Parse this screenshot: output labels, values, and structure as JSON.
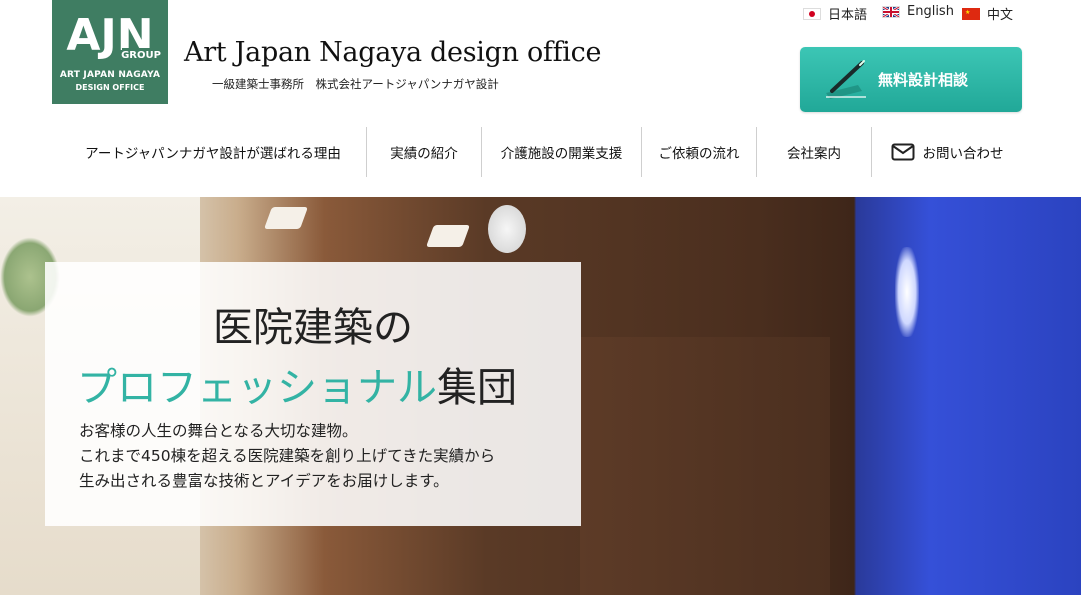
{
  "header": {
    "logo": {
      "mark": "AJN",
      "group": "GROUP",
      "line1": "ART JAPAN NAGAYA",
      "line2": "DESIGN OFFICE"
    },
    "title": "Art Japan Nagaya design office",
    "subtitle": "一級建築士事務所　株式会社アートジャパンナガヤ設計",
    "languages": [
      {
        "label": "日本語",
        "flag": "jp-flag-icon"
      },
      {
        "label": "English",
        "flag": "uk-flag-icon"
      },
      {
        "label": "中文",
        "flag": "cn-flag-icon"
      }
    ],
    "cta": {
      "label": "無料設計相談",
      "icon": "pen-icon"
    }
  },
  "nav": {
    "items": [
      {
        "label": "アートジャパンナガヤ設計が選ばれる理由"
      },
      {
        "label": "実績の紹介"
      },
      {
        "label": "介護施設の開業支援"
      },
      {
        "label": "ご依頼の流れ"
      },
      {
        "label": "会社案内"
      },
      {
        "label": "お問い合わせ",
        "icon": "mail-icon"
      }
    ]
  },
  "hero": {
    "heading_line1": "医院建築の",
    "heading_accent": "プロフェッショナル",
    "heading_rest": "集団",
    "body": [
      "お客様の人生の舞台となる大切な建物。",
      "これまで450棟を超える医院建築を創り上げてきた実績から",
      "生み出される豊富な技術とアイデアをお届けします。"
    ]
  },
  "colors": {
    "logo_bg": "#3f7d62",
    "accent": "#33b3a4",
    "cta_bg": "#21a898"
  }
}
